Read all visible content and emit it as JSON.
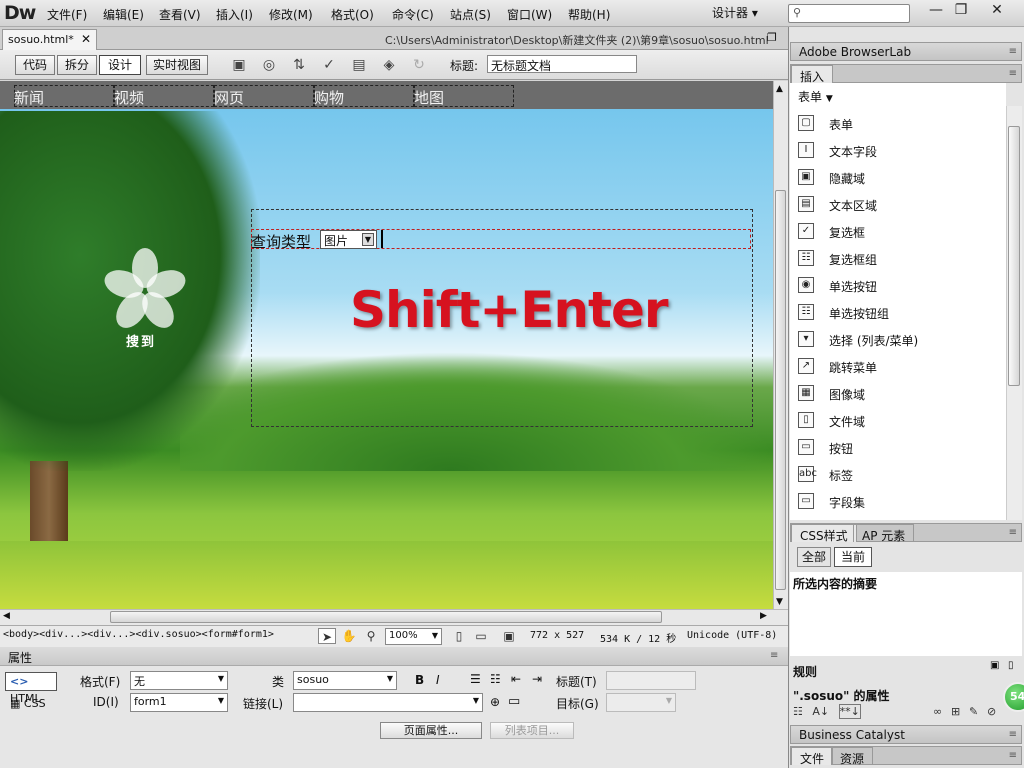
{
  "app": {
    "logo": "Dw",
    "workspace": "设计器 ▾"
  },
  "menu": [
    "文件(F)",
    "编辑(E)",
    "查看(V)",
    "插入(I)",
    "修改(M)",
    "格式(O)",
    "命令(C)",
    "站点(S)",
    "窗口(W)",
    "帮助(H)"
  ],
  "window_buttons": {
    "minimize": "—",
    "restore": "❐",
    "close": "✕"
  },
  "document": {
    "tab": "sosuo.html*",
    "path": "C:\\Users\\Administrator\\Desktop\\新建文件夹 (2)\\第9章\\sosuo\\sosuo.html"
  },
  "toolbar": {
    "views": [
      "代码",
      "拆分",
      "设计",
      "实时视图"
    ],
    "active_view": "设计",
    "title_label": "标题:",
    "title_value": "无标题文档"
  },
  "page": {
    "nav": [
      "新闻",
      "视频",
      "网页",
      "购物",
      "地图"
    ],
    "logo_text": "搜到",
    "search_label": "查询类型",
    "search_select": "图片",
    "overlay_text": "Shift+Enter"
  },
  "status": {
    "tag_selector": "<body><div...><div...><div.sosuo><form#form1>",
    "zoom": "100%",
    "window_size": "772 x 527",
    "file_size": "534 K / 12 秒",
    "encoding": "Unicode (UTF-8)"
  },
  "properties": {
    "header": "属性",
    "html_btn": "HTML",
    "css_btn": "CSS",
    "format_label": "格式(F)",
    "format_value": "无",
    "id_label": "ID(I)",
    "id_value": "form1",
    "class_label": "类",
    "class_value": "sosuo",
    "link_label": "链接(L)",
    "link_value": "",
    "bold": "B",
    "italic": "I",
    "title_label": "标题(T)",
    "target_label": "目标(G)",
    "page_props_btn": "页面属性...",
    "list_item_btn": "列表项目..."
  },
  "panels": {
    "browserlab": "Adobe BrowserLab",
    "insert_tab": "插入",
    "insert_category": "表单",
    "insert_items": [
      {
        "icon": "form-icon",
        "glyph": "▢",
        "label": "表单"
      },
      {
        "icon": "text-field-icon",
        "glyph": "I",
        "label": "文本字段"
      },
      {
        "icon": "hidden-field-icon",
        "glyph": "▣",
        "label": "隐藏域"
      },
      {
        "icon": "textarea-icon",
        "glyph": "▤",
        "label": "文本区域"
      },
      {
        "icon": "checkbox-icon",
        "glyph": "✓",
        "label": "复选框"
      },
      {
        "icon": "checkbox-group-icon",
        "glyph": "☷",
        "label": "复选框组"
      },
      {
        "icon": "radio-icon",
        "glyph": "◉",
        "label": "单选按钮"
      },
      {
        "icon": "radio-group-icon",
        "glyph": "☷",
        "label": "单选按钮组"
      },
      {
        "icon": "select-icon",
        "glyph": "▾",
        "label": "选择 (列表/菜单)"
      },
      {
        "icon": "jump-menu-icon",
        "glyph": "↗",
        "label": "跳转菜单"
      },
      {
        "icon": "image-field-icon",
        "glyph": "▦",
        "label": "图像域"
      },
      {
        "icon": "file-field-icon",
        "glyph": "▯",
        "label": "文件域"
      },
      {
        "icon": "button-icon",
        "glyph": "▭",
        "label": "按钮"
      },
      {
        "icon": "label-icon",
        "glyph": "abc",
        "label": "标签"
      },
      {
        "icon": "fieldset-icon",
        "glyph": "▭",
        "label": "字段集"
      }
    ],
    "css_tab": "CSS样式",
    "ap_tab": "AP 元素",
    "css_all": "全部",
    "css_current": "当前",
    "summary": "所选内容的摘要",
    "rules": "规则",
    "selector_props": "\".sosuo\" 的属性",
    "badge": "54",
    "business_catalyst": "Business Catalyst",
    "files_tab": "文件",
    "assets_tab": "资源"
  }
}
